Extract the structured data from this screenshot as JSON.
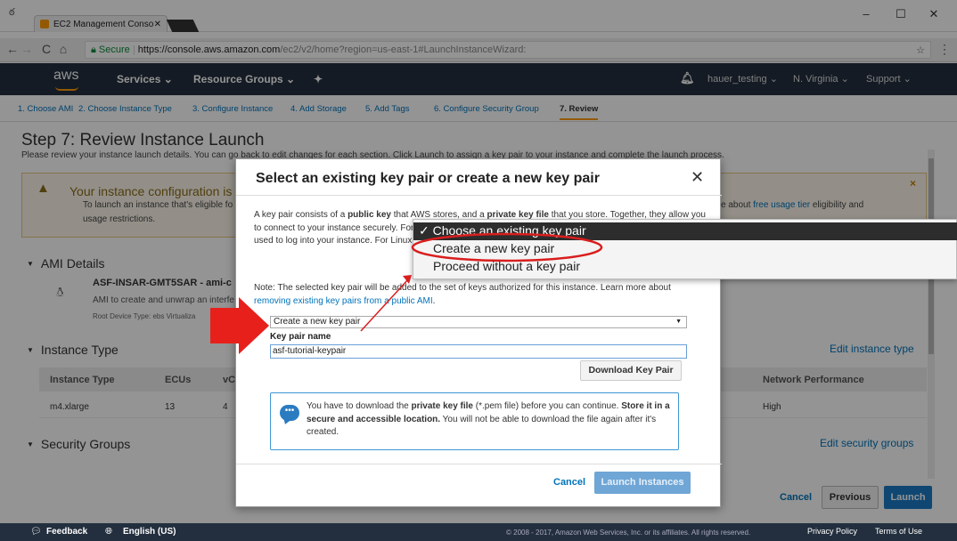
{
  "browser": {
    "tab_title": "EC2 Management Conso",
    "secure_label": "Secure",
    "url_host": "https://console.aws.amazon.com",
    "url_path": "/ec2/v2/home?region=us-east-1#LaunchInstanceWizard:"
  },
  "awsnav": {
    "logo": "aws",
    "services": "Services ⌄",
    "resource_groups": "Resource Groups ⌄",
    "user": "hauer_testing ⌄",
    "region": "N. Virginia ⌄",
    "support": "Support ⌄"
  },
  "steps": [
    "1. Choose AMI",
    "2. Choose Instance Type",
    "3. Configure Instance",
    "4. Add Storage",
    "5. Add Tags",
    "6. Configure Security Group",
    "7. Review"
  ],
  "page": {
    "title": "Step 7: Review Instance Launch",
    "subtitle": "Please review your instance launch details. You can go back to edit changes for each section. Click Launch to assign a key pair to your instance and complete the launch process.",
    "warning_title": "Your instance configuration is",
    "warning_text_1": "To launch an instance that's eligible fo",
    "warning_text_2": "usage restrictions.",
    "warning_right": "e about",
    "warning_link": "free usage tier",
    "warning_right2": "eligibility and",
    "ami_section": "AMI Details",
    "ami_name": "ASF-INSAR-GMT5SAR - ami-c",
    "ami_desc": "AMI to create and unwrap an interfe",
    "ami_meta": "Root Device Type: ebs   Virtualiza",
    "instance_section": "Instance Type",
    "edit_instance_type": "Edit instance type",
    "col_instance_type": "Instance Type",
    "col_ecus": "ECUs",
    "col_vc": "vC",
    "col_network": "Network Performance",
    "row_type": "m4.xlarge",
    "row_ecus": "13",
    "row_vc": "4",
    "row_network": "High",
    "security_section": "Security Groups",
    "edit_security_groups": "Edit security groups",
    "btn_cancel": "Cancel",
    "btn_previous": "Previous",
    "btn_launch": "Launch"
  },
  "modal": {
    "title": "Select an existing key pair or create a new key pair",
    "close": "✕",
    "desc_a": "A key pair consists of a ",
    "desc_b": "public key",
    "desc_c": " that AWS stores, and a ",
    "desc_d": "private key file",
    "desc_e": " that you store. Together, they allow you to connect to your instance securely. For Windows AMIs, the private key file is required to obtain the password used to log into your instance. For Linux AMIs, the private key file allows you to securely SSH into your instance.",
    "note_a": "Note: The selected key pair will be added to the set of keys authorized for this instance. Learn more about ",
    "note_link": "removing existing key pairs from a public AMI",
    "note_b": ".",
    "select_value": "Create a new key pair",
    "key_pair_label": "Key pair name",
    "key_pair_value": "asf-tutorial-keypair",
    "download_btn": "Download Key Pair",
    "info_a": "You have to download the ",
    "info_b": "private key file",
    "info_c": " (*.pem file) before you can continue. ",
    "info_d": "Store it in a secure and accessible location.",
    "info_e": " You will not be able to download the file again after it's created.",
    "cancel": "Cancel",
    "launch": "Launch Instances"
  },
  "dropdown": {
    "options": [
      "✓ Choose an existing key pair",
      "Create a new key pair",
      "Proceed without a key pair"
    ]
  },
  "footer": {
    "feedback": "Feedback",
    "language": "English (US)",
    "copyright": "© 2008 - 2017, Amazon Web Services, Inc. or its affiliates. All rights reserved.",
    "privacy": "Privacy Policy",
    "terms": "Terms of Use"
  },
  "colors": {
    "accent": "#f90",
    "highlight_circle": "#d91e1e",
    "arrow": "#e8201c"
  }
}
